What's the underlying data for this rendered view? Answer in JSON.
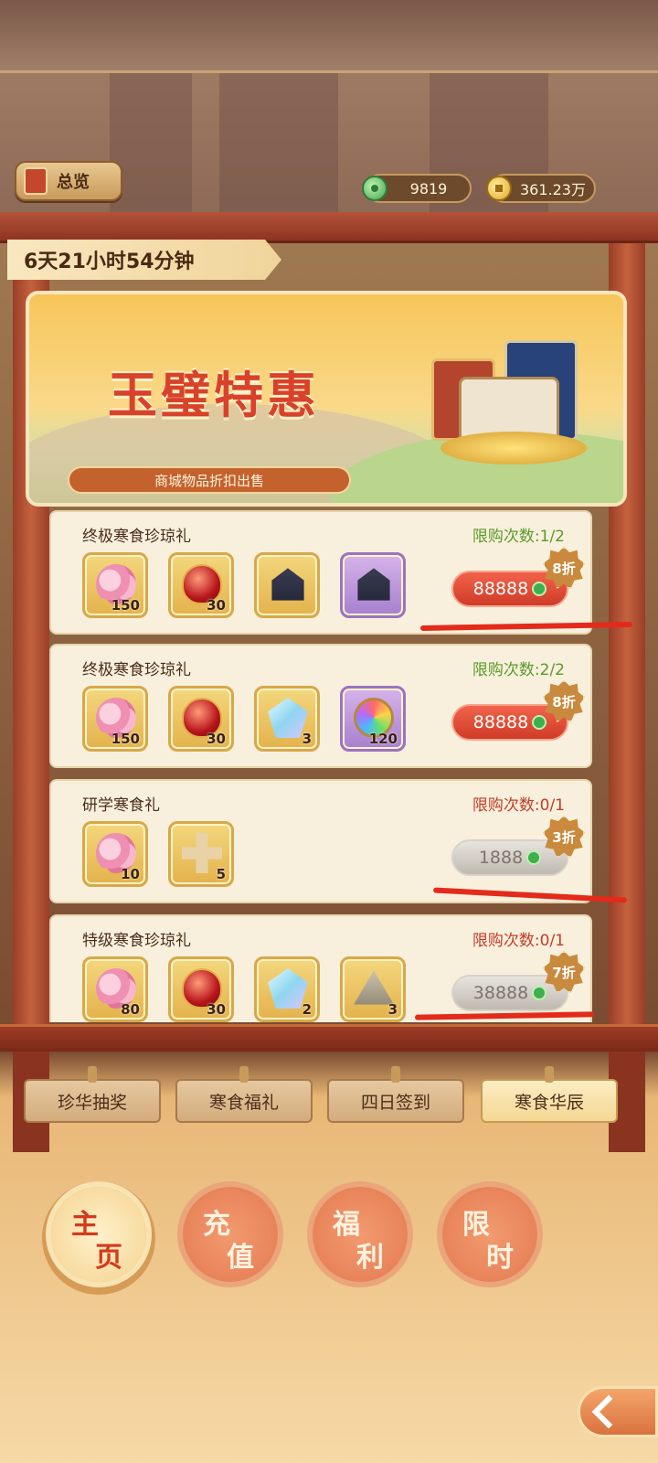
{
  "header": {
    "overview_label": "总览",
    "jade_amount": "9819",
    "gold_amount": "361.23万"
  },
  "timer": "6天21小时54分钟",
  "banner": {
    "title": "玉璧特惠",
    "subtitle": "商城物品折扣出售"
  },
  "cards": [
    {
      "name": "终极寒食珍琼礼",
      "limit": "限购次数:1/2",
      "items": [
        {
          "icon": "peony-icon",
          "qty": "150"
        },
        {
          "icon": "red-gem-icon",
          "qty": "30"
        },
        {
          "icon": "house-icon",
          "qty": ""
        },
        {
          "icon": "house-icon",
          "qty": ""
        }
      ],
      "price": "88888",
      "discount": "8折"
    },
    {
      "name": "终极寒食珍琼礼",
      "limit": "限购次数:2/2",
      "items": [
        {
          "icon": "peony-icon",
          "qty": "150"
        },
        {
          "icon": "red-gem-icon",
          "qty": "30"
        },
        {
          "icon": "crystal-icon",
          "qty": "3"
        },
        {
          "icon": "rainbow-basket-icon",
          "qty": "120"
        }
      ],
      "price": "88888",
      "discount": "8折"
    },
    {
      "name": "研学寒食礼",
      "limit": "限购次数:0/1",
      "items": [
        {
          "icon": "peony-icon",
          "qty": "10"
        },
        {
          "icon": "cross-block-icon",
          "qty": "5"
        }
      ],
      "price": "1888",
      "discount": "3折"
    },
    {
      "name": "特级寒食珍琼礼",
      "limit": "限购次数:0/1",
      "items": [
        {
          "icon": "peony-icon",
          "qty": "80"
        },
        {
          "icon": "red-gem-icon",
          "qty": "30"
        },
        {
          "icon": "crystal-icon",
          "qty": "2"
        },
        {
          "icon": "tent-icon",
          "qty": "3"
        }
      ],
      "price": "38888",
      "discount": "7折"
    }
  ],
  "tabs": [
    "珍华抽奖",
    "寒食福礼",
    "四日签到",
    "寒食华辰"
  ],
  "nav": [
    {
      "c1": "主",
      "c2": "页"
    },
    {
      "c1": "充",
      "c2": "值"
    },
    {
      "c1": "福",
      "c2": "利"
    },
    {
      "c1": "限",
      "c2": "时"
    }
  ],
  "colors": {
    "accent_red": "#cf3c28",
    "frame_red": "#9a3e28",
    "limit_green": "#5a9a2a",
    "limit_red": "#c33c28",
    "annotation_red": "#e42a1a"
  }
}
